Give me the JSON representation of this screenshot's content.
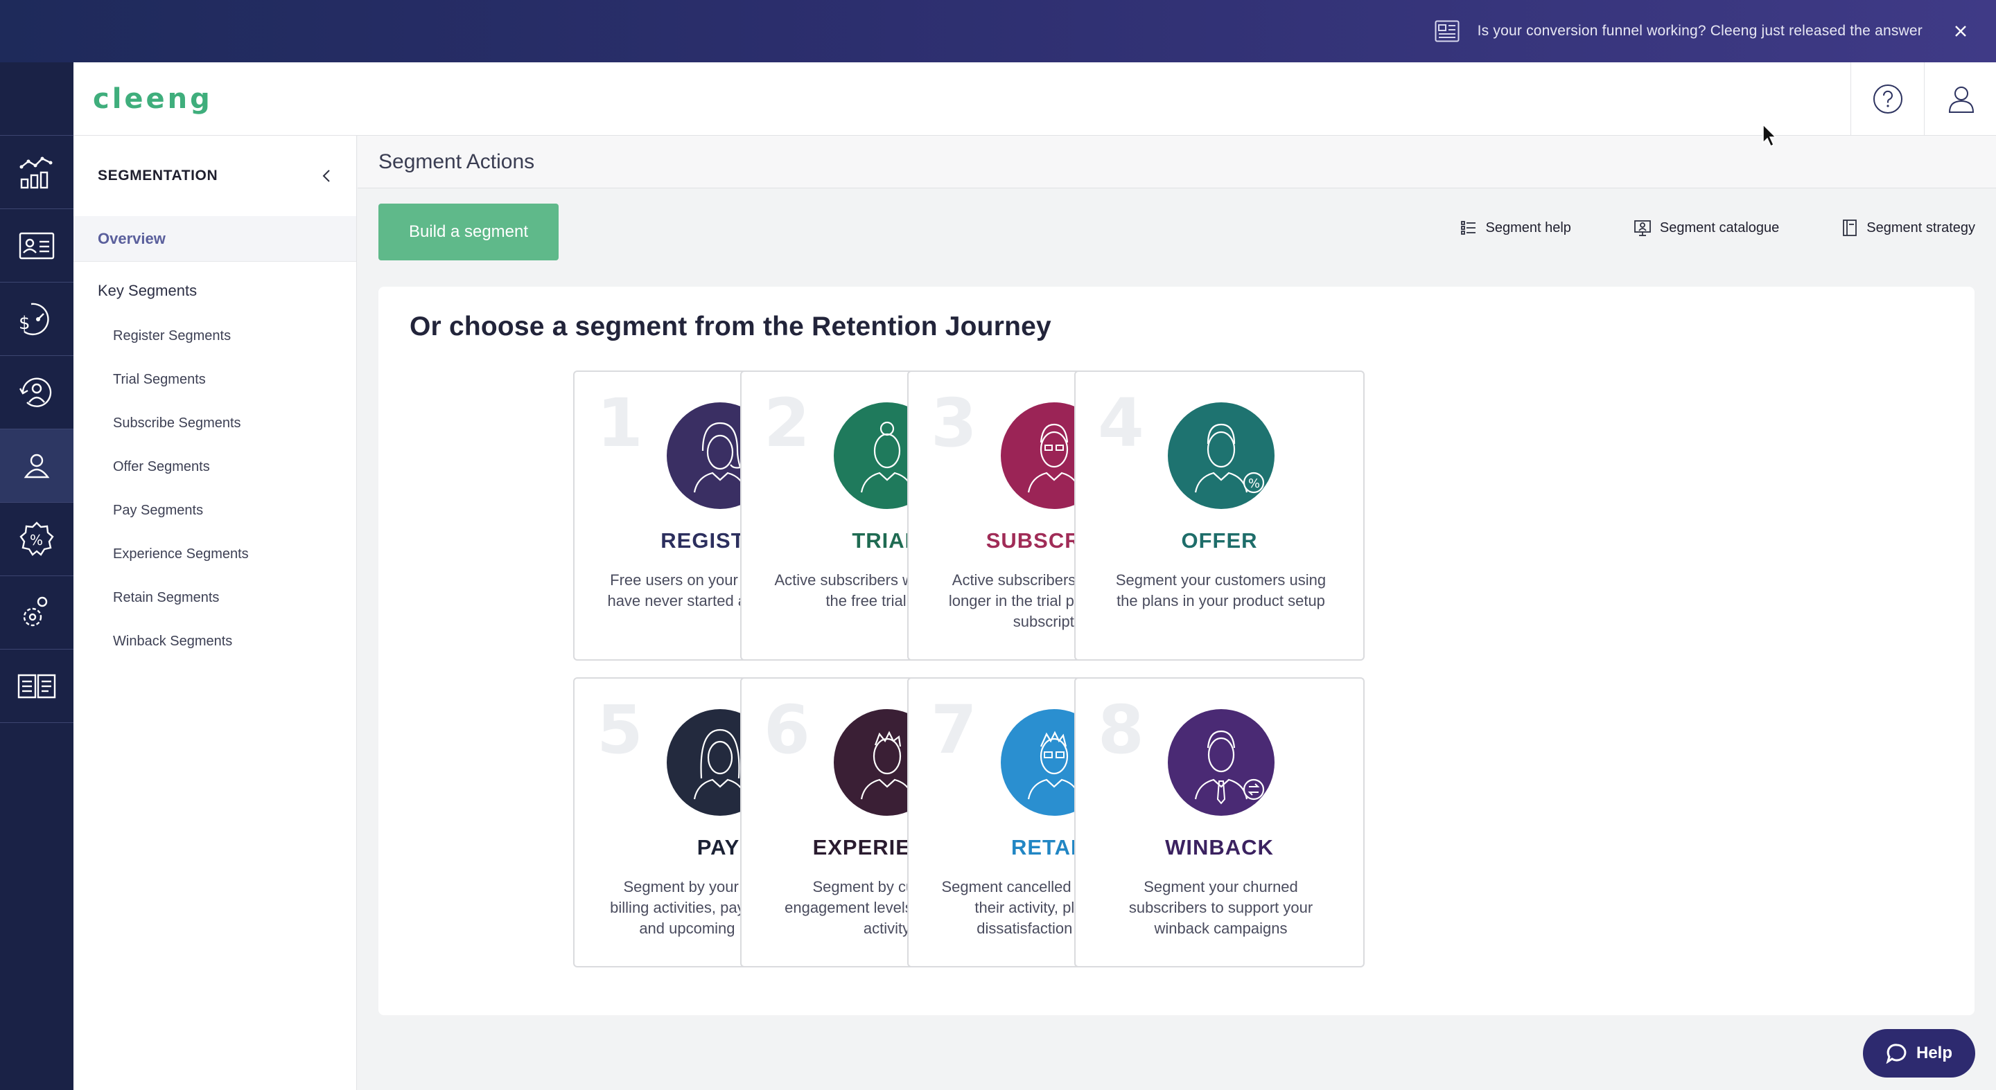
{
  "banner": {
    "text": "Is your conversion funnel working? Cleeng just released the answer"
  },
  "header": {
    "logo": "cleeng"
  },
  "left_rail": {
    "icons": [
      "analytics-icon",
      "subscribers-icon",
      "revenue-icon",
      "retention-icon",
      "segments-icon",
      "offers-icon",
      "settings-icon",
      "docs-icon"
    ],
    "active_index": 4
  },
  "sidebar": {
    "title": "SEGMENTATION",
    "overview": "Overview",
    "section": "Key Segments",
    "items": [
      "Register Segments",
      "Trial Segments",
      "Subscribe Segments",
      "Offer Segments",
      "Pay Segments",
      "Experience Segments",
      "Retain Segments",
      "Winback Segments"
    ]
  },
  "main": {
    "page_title": "Segment Actions",
    "build_button": "Build a segment",
    "links": {
      "help": "Segment help",
      "catalogue": "Segment catalogue",
      "strategy": "Segment strategy"
    },
    "journey_title": "Or choose a segment from the Retention Journey",
    "cards": [
      {
        "num": "1",
        "title": "REGISTER",
        "desc": "Free users on your platform who have never started a subscription",
        "color": "#2c2f5e",
        "avatar_bg": "#3a2f63",
        "badge": "check"
      },
      {
        "num": "2",
        "title": "TRIAL",
        "desc": "Active subscribers who are still in the free trial stage",
        "color": "#1f6b52",
        "avatar_bg": "#1f7a5c",
        "badge": "clock"
      },
      {
        "num": "3",
        "title": "SUBSCRIBE",
        "desc": "Active subscribers who are no longer in the trial period of their subscription",
        "color": "#a02c57",
        "avatar_bg": "#9b2456",
        "badge": "play"
      },
      {
        "num": "4",
        "title": "OFFER",
        "desc": "Segment your customers using the plans in your product setup",
        "color": "#1e6d6a",
        "avatar_bg": "#1e7370",
        "badge": "percent"
      },
      {
        "num": "5",
        "title": "PAY",
        "desc": "Segment by your customers' billing activities, payment cycles, and upcoming renewals",
        "color": "#1c2235",
        "avatar_bg": "#232a3e",
        "badge": "dollar"
      },
      {
        "num": "6",
        "title": "EXPERIENCE",
        "desc": "Segment by customer engagement levels and recent activity",
        "color": "#2a1b2f",
        "avatar_bg": "#3a1f35",
        "badge": "exclaim"
      },
      {
        "num": "7",
        "title": "RETAIN",
        "desc": "Segment cancelled customers by their activity, plans, and dissatisfaction reasons",
        "color": "#2186c4",
        "avatar_bg": "#2a8fd0",
        "badge": "minus"
      },
      {
        "num": "8",
        "title": "WINBACK",
        "desc": "Segment your churned subscribers to support your winback campaigns",
        "color": "#3b2260",
        "avatar_bg": "#4a2a74",
        "badge": "swap"
      }
    ]
  },
  "help_fab": "Help"
}
